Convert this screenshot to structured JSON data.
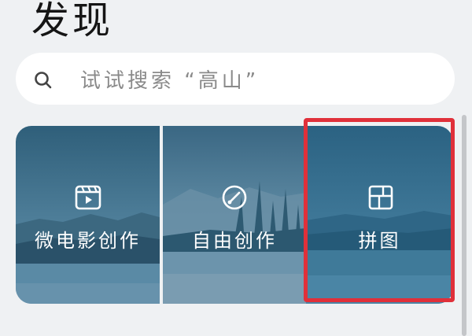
{
  "header": {
    "title": "发现"
  },
  "search": {
    "placeholder": "试试搜索 “高山”",
    "icon": "search-icon"
  },
  "creation_cards": [
    {
      "label": "微电影创作",
      "icon": "film-icon"
    },
    {
      "label": "自由创作",
      "icon": "brush-icon"
    },
    {
      "label": "拼图",
      "icon": "collage-icon"
    }
  ],
  "colors": {
    "background": "#eff1f3",
    "highlight": "#e0303a",
    "card_sky": "#3f6e89",
    "card_water": "#5b8eab"
  }
}
